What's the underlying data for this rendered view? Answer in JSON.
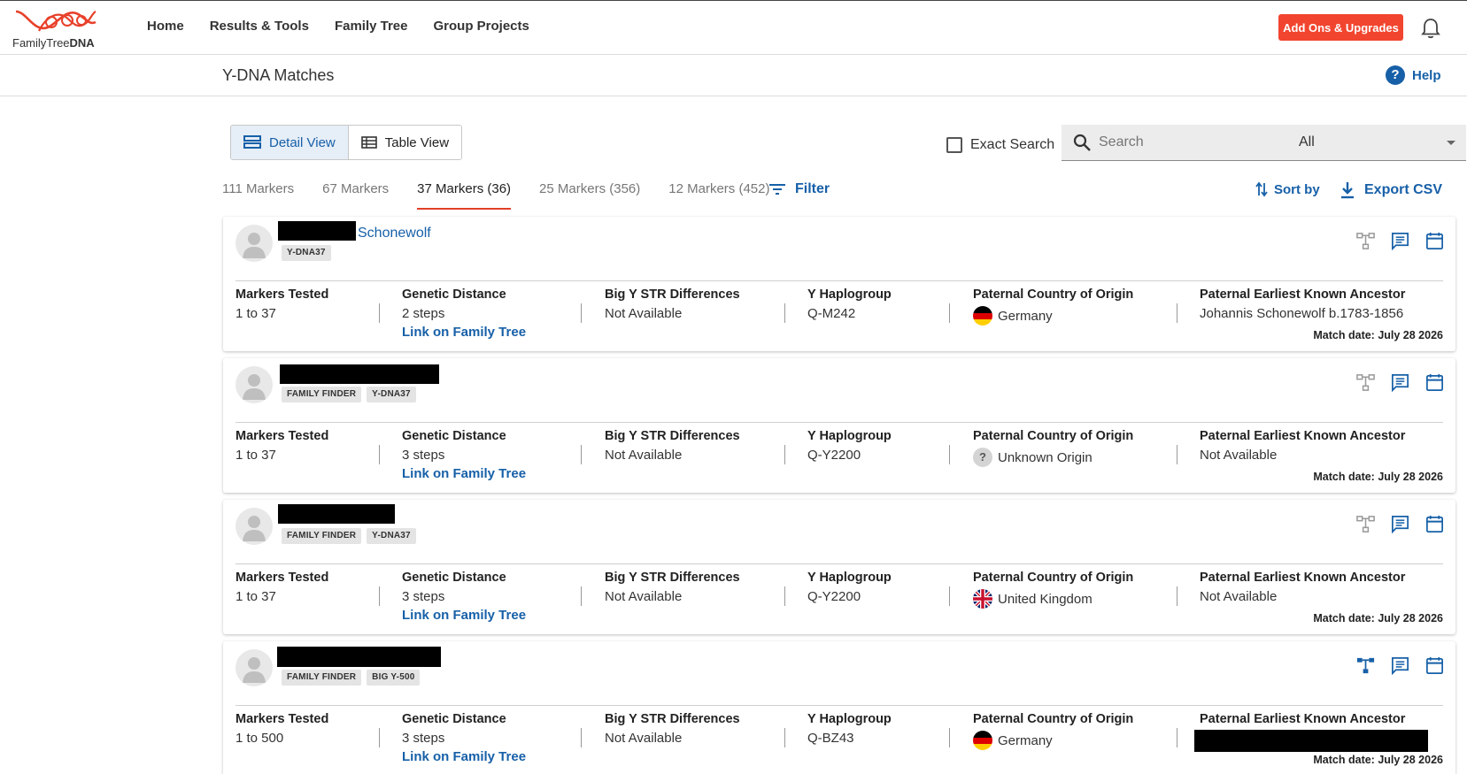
{
  "header": {
    "logo_text_light": "FamilyTree",
    "logo_text_bold": "DNA",
    "nav": [
      "Home",
      "Results & Tools",
      "Family Tree",
      "Group Projects"
    ],
    "addons_label": "Add Ons & Upgrades"
  },
  "subheader": {
    "title": "Y-DNA Matches",
    "help_label": "Help"
  },
  "toolbar": {
    "detail_view": "Detail View",
    "table_view": "Table View",
    "exact_search": "Exact Search",
    "search_placeholder": "Search",
    "filter_select": "All",
    "filter_label": "Filter",
    "sort_label": "Sort by",
    "export_label": "Export CSV"
  },
  "tabs": [
    "111 Markers",
    "67 Markers",
    "37 Markers (36)",
    "25 Markers (356)",
    "12 Markers (452)"
  ],
  "active_tab": "37 Markers (36)",
  "column_labels": {
    "markers": "Markers Tested",
    "distance": "Genetic Distance",
    "bigy": "Big Y STR Differences",
    "haplo": "Y Haplogroup",
    "country": "Paternal Country of Origin",
    "ancestor": "Paternal Earliest Known Ancestor"
  },
  "link_family_tree": "Link on Family Tree",
  "matches": [
    {
      "name": "Schonewolf",
      "badges": [
        "Y-DNA37"
      ],
      "markers": "1 to 37",
      "distance": "2 steps",
      "bigy": "Not Available",
      "haplo": "Q-M242",
      "country": "Germany",
      "ancestor": "Johannis Schonewolf b.1783-1856",
      "match_date": "Match date: July 28 2026"
    },
    {
      "name": "",
      "badges": [
        "FAMILY FINDER",
        "Y-DNA37"
      ],
      "markers": "1 to 37",
      "distance": "3 steps",
      "bigy": "Not Available",
      "haplo": "Q-Y2200",
      "country": "Unknown Origin",
      "ancestor": "Not Available",
      "match_date": "Match date: July 28 2026"
    },
    {
      "name": "",
      "badges": [
        "FAMILY FINDER",
        "Y-DNA37"
      ],
      "markers": "1 to 37",
      "distance": "3 steps",
      "bigy": "Not Available",
      "haplo": "Q-Y2200",
      "country": "United Kingdom",
      "ancestor": "Not Available",
      "match_date": "Match date: July 28 2026"
    },
    {
      "name": "",
      "badges": [
        "FAMILY FINDER",
        "BIG Y-500"
      ],
      "markers": "1 to 500",
      "distance": "3 steps",
      "bigy": "Not Available",
      "haplo": "Q-BZ43",
      "country": "Germany",
      "ancestor": "",
      "match_date": "Match date: July 28 2026"
    }
  ],
  "colors": {
    "brand_red": "#f2452f",
    "link_blue": "#1760a8",
    "tab_underline": "#e04127"
  }
}
